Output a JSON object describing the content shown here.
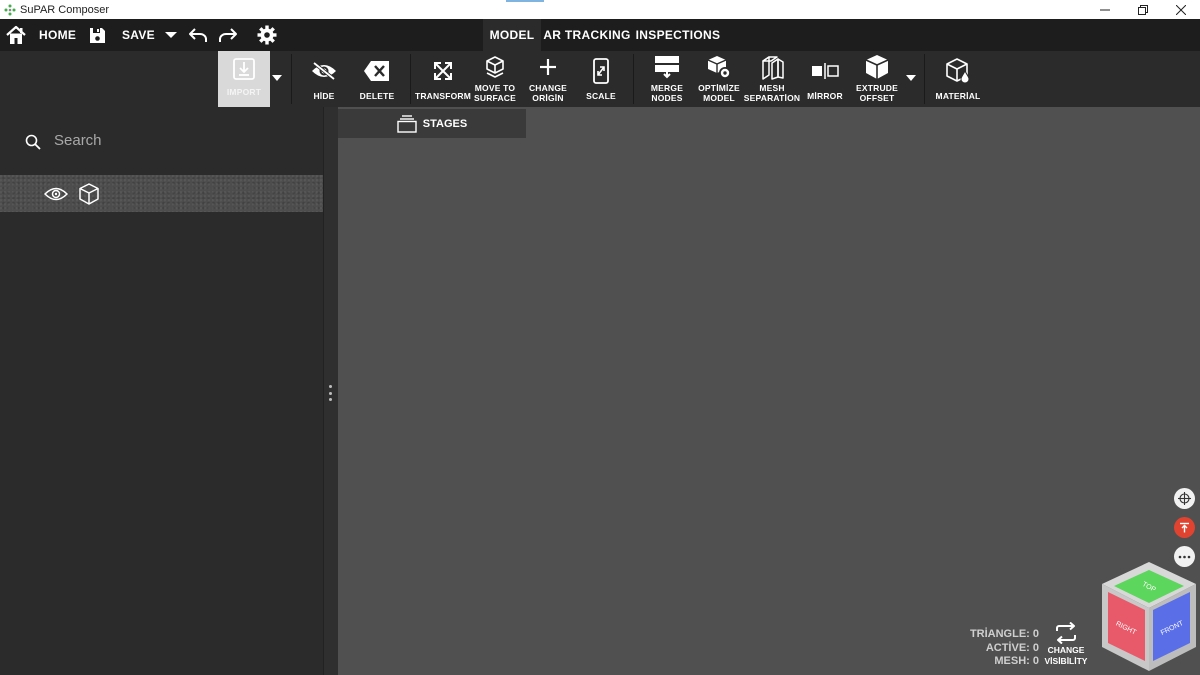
{
  "window": {
    "title": "SuPAR Composer",
    "controls": [
      "minimize-icon",
      "restore-icon",
      "close-icon"
    ]
  },
  "topnav": {
    "home_label": "HOME",
    "save_label": "SAVE",
    "tabs": [
      {
        "label": "MODEL",
        "active": true
      },
      {
        "label": "AR TRACKING",
        "active": false
      },
      {
        "label": "INSPECTIONS",
        "active": false
      }
    ]
  },
  "ribbon": {
    "import": "IMPORT",
    "hide": "HİDE",
    "delete": "DELETE",
    "transform": "TRANSFORM",
    "move_to_surface_1": "MOVE TO",
    "move_to_surface_2": "SURFACE",
    "change_origin_1": "CHANGE",
    "change_origin_2": "ORİGİN",
    "scale": "SCALE",
    "merge_nodes_1": "MERGE",
    "merge_nodes_2": "NODES",
    "optimize_model_1": "OPTİMİZE",
    "optimize_model_2": "MODEL",
    "mesh_separation_1": "MESH",
    "mesh_separation_2": "SEPARATİON",
    "mirror": "MİRROR",
    "extrude_offset_1": "EXTRUDE",
    "extrude_offset_2": "OFFSET",
    "material": "MATERİAL"
  },
  "sidebar": {
    "search_placeholder": "Search"
  },
  "viewport": {
    "stages_label": "STAGES",
    "stats": {
      "triangle": "TRİANGLE: 0",
      "active": "ACTİVE: 0",
      "mesh": "MESH: 0"
    },
    "change_visibility_1": "CHANGE",
    "change_visibility_2": "VİSİBİLİTY",
    "nav_cube": {
      "top": "TOP",
      "right": "RIGHT",
      "front": "FRONT"
    }
  },
  "colors": {
    "top_bar": "#1d1d1d",
    "panel": "#2b2b2b",
    "viewport": "#505050",
    "import_active": "#d9d9d9",
    "red_button": "#e0432f",
    "cube_top": "#5cd65c",
    "cube_right": "#e85a6a",
    "cube_front": "#5a6ee8"
  }
}
